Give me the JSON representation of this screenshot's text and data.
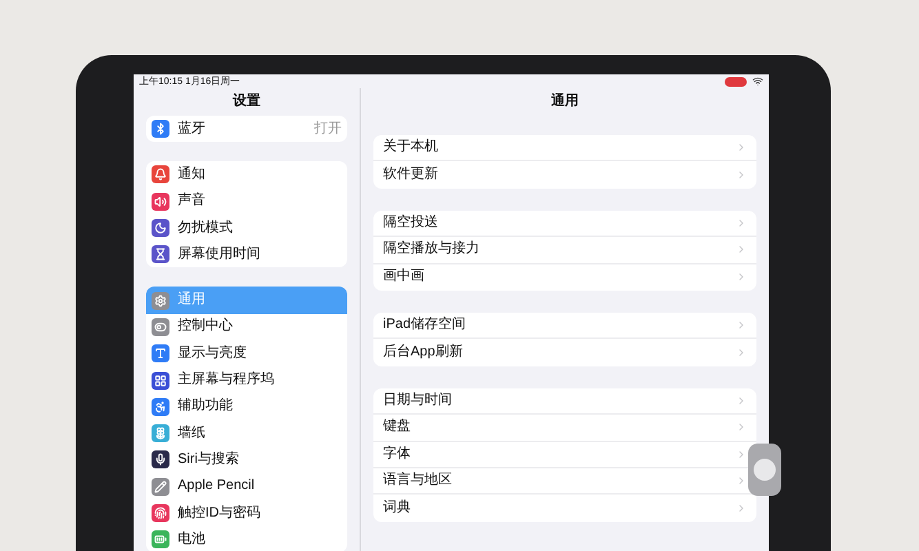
{
  "status_bar": {
    "time": "上午10:15  1月16日周一"
  },
  "sidebar": {
    "title": "设置",
    "groups": [
      [
        {
          "label": "蓝牙",
          "value": "打开",
          "color": "#2f7cf6",
          "selected": false
        }
      ],
      [
        {
          "label": "通知",
          "color": "#e8453c",
          "selected": false
        },
        {
          "label": "声音",
          "color": "#e8365d",
          "selected": false
        },
        {
          "label": "勿扰模式",
          "color": "#5b54c9",
          "selected": false
        },
        {
          "label": "屏幕使用时间",
          "color": "#5b54c9",
          "selected": false
        }
      ],
      [
        {
          "label": "通用",
          "color": "#8e8e93",
          "selected": true
        },
        {
          "label": "控制中心",
          "color": "#8e8e93",
          "selected": false
        },
        {
          "label": "显示与亮度",
          "color": "#2f7cf6",
          "selected": false
        },
        {
          "label": "主屏幕与程序坞",
          "color": "#3b4fd6",
          "selected": false
        },
        {
          "label": "辅助功能",
          "color": "#2f7cf6",
          "selected": false
        },
        {
          "label": "墙纸",
          "color": "#38aed6",
          "selected": false
        },
        {
          "label": "Siri与搜索",
          "color": "#2a2a4a",
          "selected": false
        },
        {
          "label": "Apple Pencil",
          "color": "#8e8e93",
          "selected": false
        },
        {
          "label": "触控ID与密码",
          "color": "#e8365d",
          "selected": false
        },
        {
          "label": "电池",
          "color": "#3bb55b",
          "selected": false
        }
      ]
    ]
  },
  "detail": {
    "title": "通用",
    "groups": [
      [
        "关于本机",
        "软件更新"
      ],
      [
        "隔空投送",
        "隔空播放与接力",
        "画中画"
      ],
      [
        "iPad储存空间",
        "后台App刷新"
      ],
      [
        "日期与时间",
        "键盘",
        "字体",
        "语言与地区",
        "词典"
      ]
    ]
  }
}
